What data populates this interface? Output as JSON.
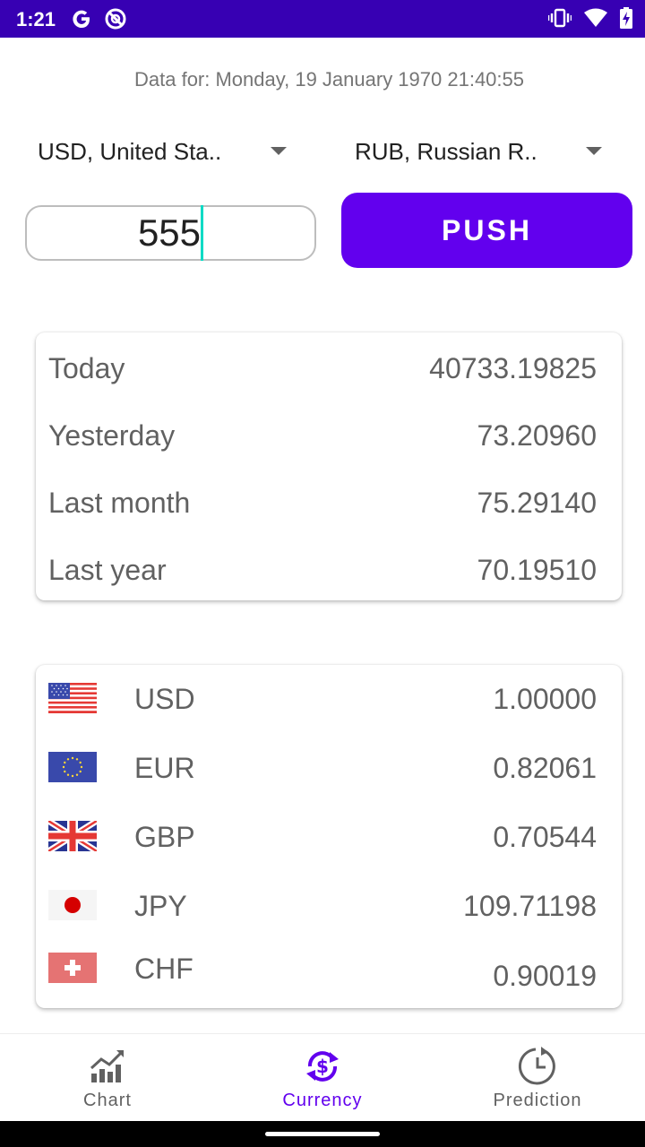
{
  "status_bar": {
    "time": "1:21",
    "icons": [
      "google-icon",
      "no-disturb-icon",
      "vibrate-icon",
      "wifi-icon",
      "battery-charging-icon"
    ]
  },
  "header": {
    "data_for": "Data for: Monday, 19 January 1970 21:40:55"
  },
  "converter": {
    "from_currency": "USD, United Sta..",
    "to_currency": "RUB, Russian R..",
    "amount": "555",
    "push_label": "PUSH"
  },
  "rates": [
    {
      "label": "Today",
      "value": "40733.19825"
    },
    {
      "label": "Yesterday",
      "value": "73.20960"
    },
    {
      "label": "Last month",
      "value": "75.29140"
    },
    {
      "label": "Last year",
      "value": "70.19510"
    }
  ],
  "currencies": [
    {
      "code": "USD",
      "value": "1.00000",
      "flag": "us-flag"
    },
    {
      "code": "EUR",
      "value": "0.82061",
      "flag": "eu-flag"
    },
    {
      "code": "GBP",
      "value": "0.70544",
      "flag": "uk-flag"
    },
    {
      "code": "JPY",
      "value": "109.71198",
      "flag": "jp-flag"
    },
    {
      "code": "CHF",
      "value": "0.90019",
      "flag": "ch-flag"
    }
  ],
  "bottom_nav": {
    "items": [
      {
        "label": "Chart",
        "icon": "chart-icon",
        "active": false
      },
      {
        "label": "Currency",
        "icon": "currency-exchange-icon",
        "active": true
      },
      {
        "label": "Prediction",
        "icon": "clock-history-icon",
        "active": false
      }
    ]
  },
  "colors": {
    "status_bar": "#3700b3",
    "primary": "#6200ee",
    "caret": "#03dac5",
    "text_secondary": "#616161"
  }
}
